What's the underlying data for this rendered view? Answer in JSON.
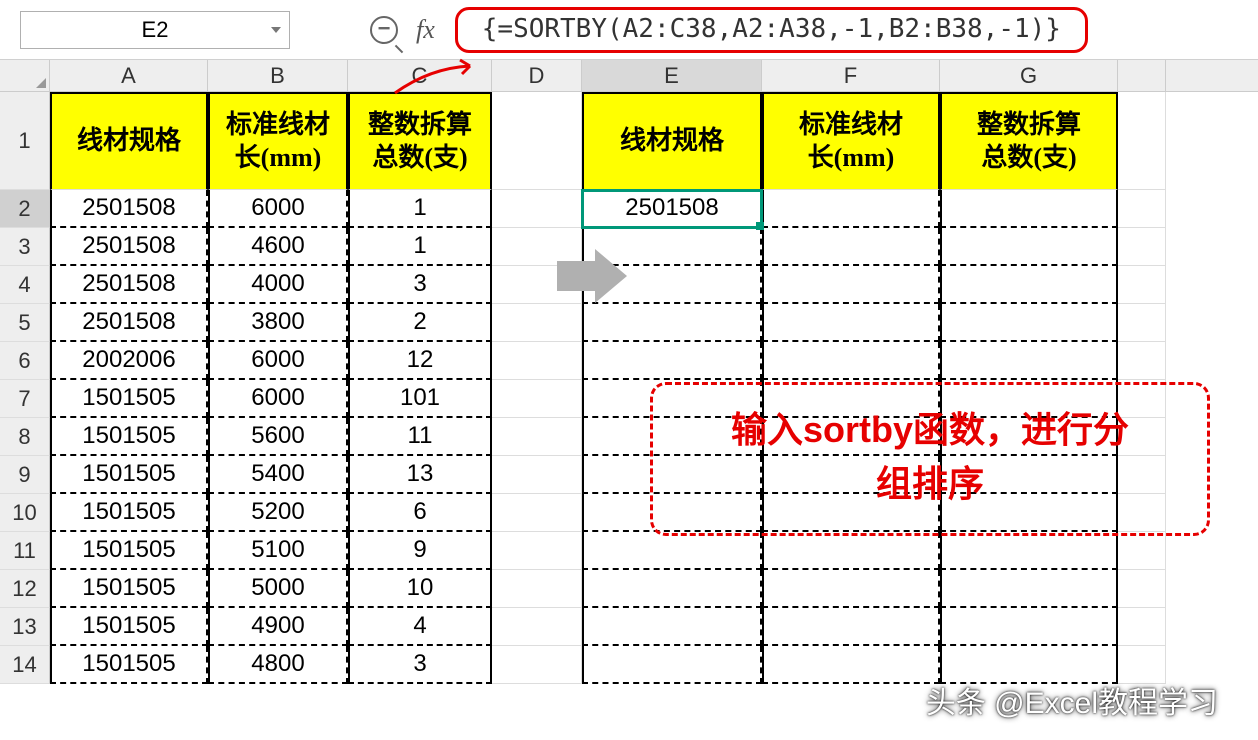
{
  "name_box": "E2",
  "fx_label": "fx",
  "formula": "{=SORTBY(A2:C38,A2:A38,-1,B2:B38,-1)}",
  "columns": [
    "A",
    "B",
    "C",
    "D",
    "E",
    "F",
    "G"
  ],
  "row_numbers": [
    1,
    2,
    3,
    4,
    5,
    6,
    7,
    8,
    9,
    10,
    11,
    12,
    13,
    14
  ],
  "left_headers": [
    "线材规格",
    "标准线材\n长(mm)",
    "整数拆算\n总数(支)"
  ],
  "right_headers": [
    "线材规格",
    "标准线材\n长(mm)",
    "整数拆算\n总数(支)"
  ],
  "left_data": [
    {
      "a": "2501508",
      "b": "6000",
      "c": "1"
    },
    {
      "a": "2501508",
      "b": "4600",
      "c": "1"
    },
    {
      "a": "2501508",
      "b": "4000",
      "c": "3"
    },
    {
      "a": "2501508",
      "b": "3800",
      "c": "2"
    },
    {
      "a": "2002006",
      "b": "6000",
      "c": "12"
    },
    {
      "a": "1501505",
      "b": "6000",
      "c": "101"
    },
    {
      "a": "1501505",
      "b": "5600",
      "c": "11"
    },
    {
      "a": "1501505",
      "b": "5400",
      "c": "13"
    },
    {
      "a": "1501505",
      "b": "5200",
      "c": "6"
    },
    {
      "a": "1501505",
      "b": "5100",
      "c": "9"
    },
    {
      "a": "1501505",
      "b": "5000",
      "c": "10"
    },
    {
      "a": "1501505",
      "b": "4900",
      "c": "4"
    },
    {
      "a": "1501505",
      "b": "4800",
      "c": "3"
    }
  ],
  "e2_value": "2501508",
  "annotation_line1": "输入sortby函数，进行分",
  "annotation_line2": "组排序",
  "watermark": "头条 @Excel教程学习"
}
